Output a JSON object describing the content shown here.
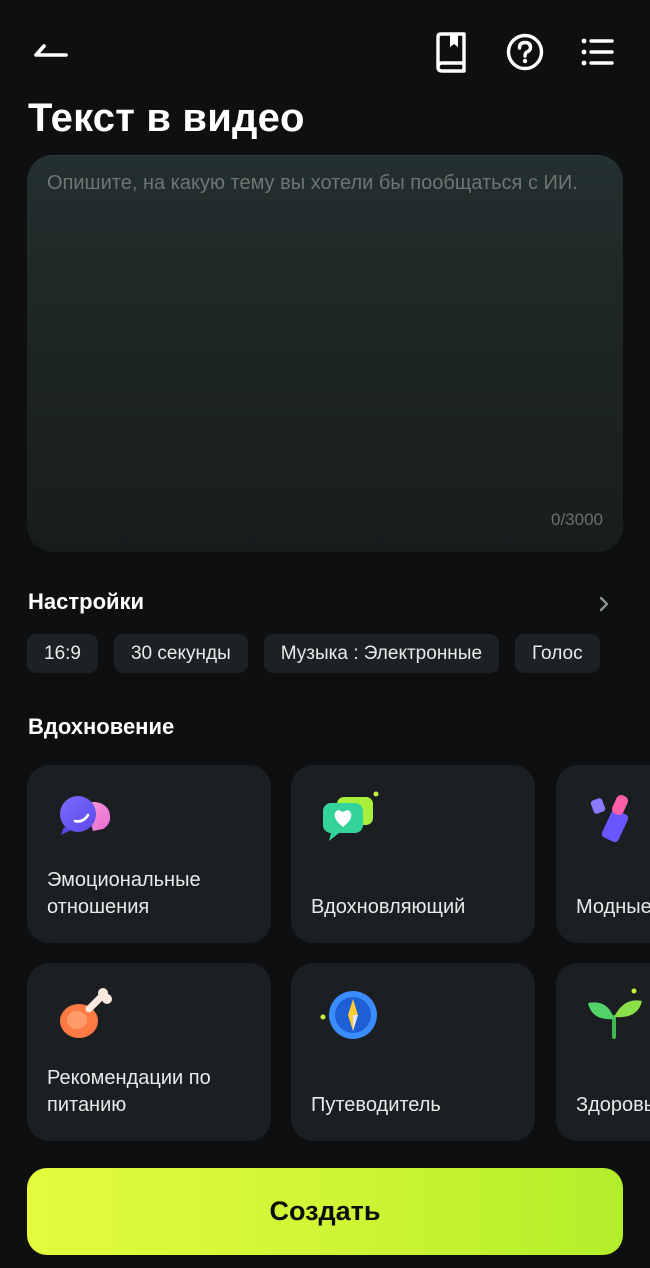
{
  "header": {
    "title": "Текст в видео",
    "icons": [
      "arrow-left-icon",
      "book-icon",
      "help-circle-icon",
      "menu-list-icon"
    ]
  },
  "prompt": {
    "value": "",
    "placeholder": "Опишите, на какую тему вы хотели бы пообщаться с ИИ.",
    "counter": "0/3000"
  },
  "settings": {
    "title": "Настройки",
    "chips": [
      {
        "label": "16:9"
      },
      {
        "label": "30 секунды"
      },
      {
        "label": "Музыка : Электронные"
      },
      {
        "label": "Голос"
      }
    ]
  },
  "inspiration": {
    "title": "Вдохновение",
    "cards": [
      {
        "label": "Эмоциональные отношения",
        "icon": "chat-bubbles-icon"
      },
      {
        "label": "Вдохновляющий",
        "icon": "heart-message-icon"
      },
      {
        "label": "Модные",
        "icon": "lipstick-icon"
      },
      {
        "label": "Рекомендации по питанию",
        "icon": "meat-icon"
      },
      {
        "label": "Путеводитель",
        "icon": "compass-icon"
      },
      {
        "label": "Здоровый образ жизни",
        "icon": "sprout-icon"
      }
    ]
  },
  "actions": {
    "create_label": "Создать"
  },
  "colors": {
    "background": "#0d0f11",
    "accent": "#d4f736",
    "card": "#1c1f22"
  }
}
